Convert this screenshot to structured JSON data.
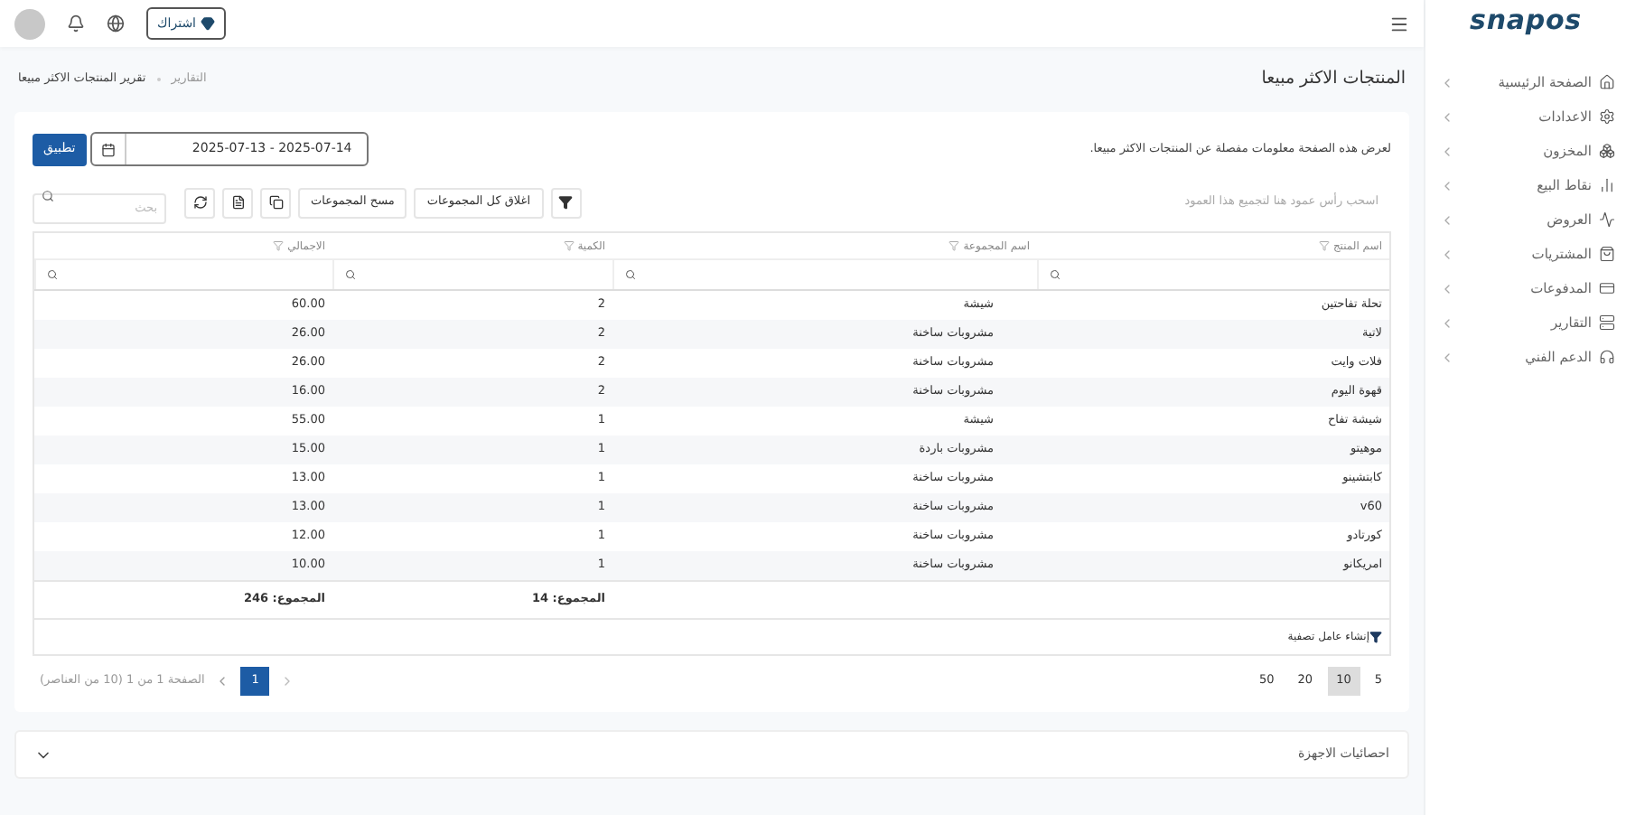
{
  "brand": {
    "logo": "snapos"
  },
  "topbar": {
    "subscribe": "اشتراك"
  },
  "sidebar": {
    "items": [
      {
        "label": "الصفحة الرئيسية"
      },
      {
        "label": "الاعدادات"
      },
      {
        "label": "المخزون"
      },
      {
        "label": "نقاط البيع"
      },
      {
        "label": "العروض"
      },
      {
        "label": "المشتريات"
      },
      {
        "label": "المدفوعات"
      },
      {
        "label": "التقارير"
      },
      {
        "label": "الدعم الفني"
      }
    ]
  },
  "page": {
    "title": "المنتجات الاكثر مبيعا",
    "breadcrumb": [
      "التقارير",
      "تقرير المنتجات الاكثر مبيعا"
    ]
  },
  "report": {
    "description": "لعرض هذه الصفحة معلومات مفصلة عن المنتجات الاكثر مبيعا.",
    "date_range": "2025-07-13 - 2025-07-14",
    "apply": "تطبيق"
  },
  "grid": {
    "group_hint": "اسحب رأس عمود هنا لتجميع هذا العمود",
    "collapse_all": "اغلاق كل المجموعات",
    "clear_groups": "مسح المجموعات",
    "search_placeholder": "بحث",
    "columns": [
      "اسم المنتج",
      "اسم المجموعة",
      "الكمية",
      "الاجمالي"
    ],
    "rows": [
      [
        "تحلة تفاحتين",
        "شيشة",
        "2",
        "60.00"
      ],
      [
        "لاتية",
        "مشروبات ساخنة",
        "2",
        "26.00"
      ],
      [
        "فلات وايت",
        "مشروبات ساخنة",
        "2",
        "26.00"
      ],
      [
        "قهوة اليوم",
        "مشروبات ساخنة",
        "2",
        "16.00"
      ],
      [
        "شيشة تفاح",
        "شيشة",
        "1",
        "55.00"
      ],
      [
        "موهيتو",
        "مشروبات باردة",
        "1",
        "15.00"
      ],
      [
        "كابتشينو",
        "مشروبات ساخنة",
        "1",
        "13.00"
      ],
      [
        "v60",
        "مشروبات ساخنة",
        "1",
        "13.00"
      ],
      [
        "كورتادو",
        "مشروبات ساخنة",
        "1",
        "12.00"
      ],
      [
        "امريكانو",
        "مشروبات ساخنة",
        "1",
        "10.00"
      ]
    ],
    "summary": {
      "quantity": "المجموع: 14",
      "total": "المجموع: 246"
    },
    "filter_builder": "إنشاء عامل تصفية",
    "page_sizes": [
      {
        "label": "5",
        "selected": false
      },
      {
        "label": "10",
        "selected": true
      },
      {
        "label": "20",
        "selected": false
      },
      {
        "label": "50",
        "selected": false
      }
    ],
    "pages": [
      {
        "label": "1",
        "selected": true
      }
    ],
    "page_info": "الصفحة 1 من 1 (10 من العناصر)"
  },
  "accordion": {
    "title": "احصائيات الاجهزة",
    "expanded": false
  }
}
